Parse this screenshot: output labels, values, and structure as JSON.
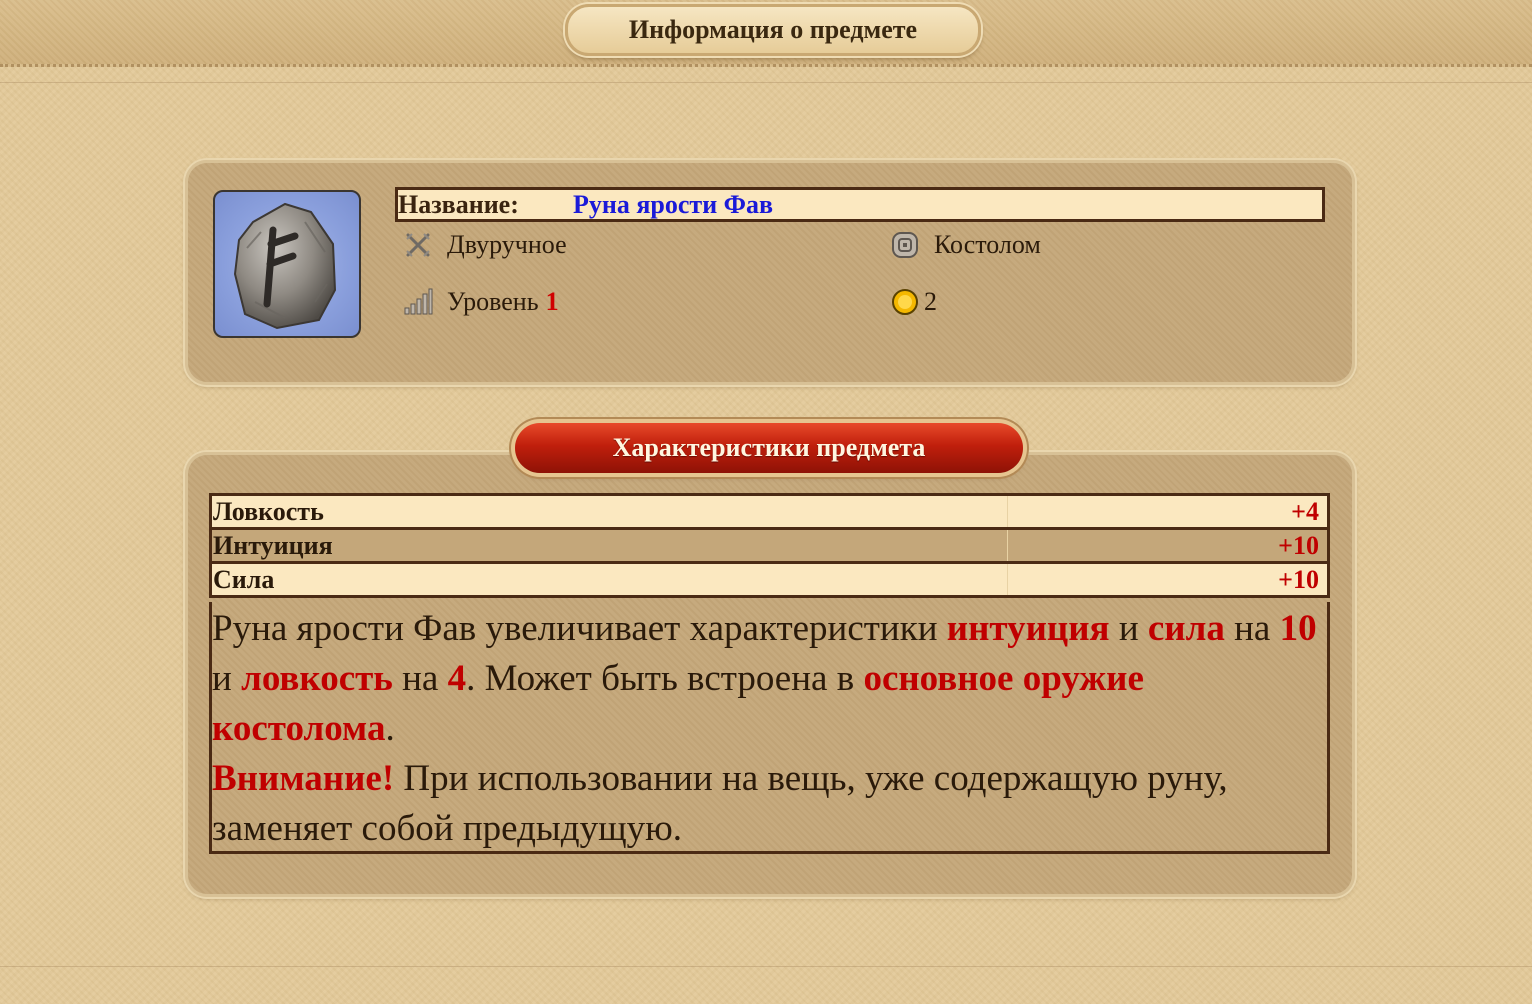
{
  "header": {
    "title": "Информация о предмете"
  },
  "item": {
    "name_label": "Название:",
    "name": "Руна ярости Фав",
    "hand_type": "Двуручное",
    "class_name": "Костолом",
    "level_label": "Уровень",
    "level": "1",
    "price": "2",
    "icons": {
      "hand": "crossed-swords-icon",
      "class": "class-emblem-icon",
      "level": "level-bars-icon",
      "price": "gold-coin-icon"
    }
  },
  "stats_section": {
    "title": "Характеристики предмета",
    "rows": [
      {
        "name": "Ловкость",
        "value": "+4"
      },
      {
        "name": "Интуиция",
        "value": "+10"
      },
      {
        "name": "Сила",
        "value": "+10"
      }
    ]
  },
  "description": {
    "p1_a": "Руна ярости Фав увеличивает характеристики ",
    "p1_b": "интуиция",
    "p1_c": " и ",
    "p1_d": "сила",
    "p1_e": " на ",
    "p1_f": "10",
    "p1_g": " и ",
    "p1_h": "ловкость",
    "p1_i": " на ",
    "p1_j": "4",
    "p1_k": ". Может быть встроена в ",
    "p1_l": "основное оружие костолома",
    "p1_m": ".",
    "warn_label": "Внимание!",
    "warn_text": " При использовании на вещь, уже содержащую руну, заменяет собой предыдущую."
  },
  "colors": {
    "background": "#e3ca9a",
    "panel": "#c4a77a",
    "row_light": "#fbe8c0",
    "border": "#4a2a14",
    "name_blue": "#1a1ad8",
    "highlight_red": "#c00000",
    "stats_pill_red": "#c01f0c"
  }
}
